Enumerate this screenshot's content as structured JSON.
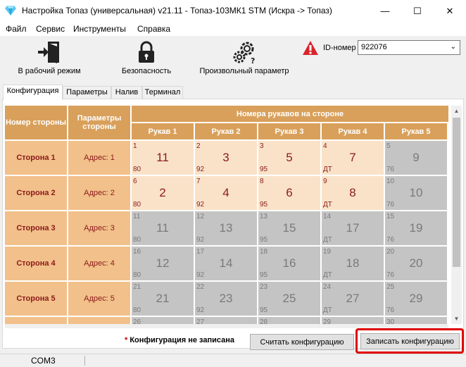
{
  "window": {
    "title": "Настройка Топаз (универсальная) v21.11 - Топаз-103МК1 STM (Искра -> Топаз)",
    "minimize": "—",
    "maximize": "☐",
    "close": "✕"
  },
  "menu": [
    "Файл",
    "Сервис",
    "Инструменты",
    "Справка"
  ],
  "toolbar": {
    "work_mode": "В рабочий режим",
    "security": "Безопасность",
    "custom_param": "Произвольный параметр"
  },
  "device": {
    "id_label": "ID-номер",
    "id_value": "922076"
  },
  "tabs": [
    "Конфигурация",
    "Параметры",
    "Налив",
    "Терминал"
  ],
  "table": {
    "header_side": "Номер стороны",
    "header_params": "Параметры стороны",
    "header_group": "Номера рукавов на стороне",
    "hoses": [
      "Рукав 1",
      "Рукав 2",
      "Рукав 3",
      "Рукав 4",
      "Рукав 5"
    ],
    "rows": [
      {
        "side": "Сторона 1",
        "addr": "Адрес: 1",
        "cells": [
          {
            "n": "1",
            "big": "11",
            "fuel": "80",
            "on": true
          },
          {
            "n": "2",
            "big": "3",
            "fuel": "92",
            "on": true
          },
          {
            "n": "3",
            "big": "5",
            "fuel": "95",
            "on": true
          },
          {
            "n": "4",
            "big": "7",
            "fuel": "ДТ",
            "on": true
          },
          {
            "n": "5",
            "big": "9",
            "fuel": "76",
            "on": false
          }
        ]
      },
      {
        "side": "Сторона 2",
        "addr": "Адрес: 2",
        "cells": [
          {
            "n": "6",
            "big": "2",
            "fuel": "80",
            "on": true
          },
          {
            "n": "7",
            "big": "4",
            "fuel": "92",
            "on": true
          },
          {
            "n": "8",
            "big": "6",
            "fuel": "95",
            "on": true
          },
          {
            "n": "9",
            "big": "8",
            "fuel": "ДТ",
            "on": true
          },
          {
            "n": "10",
            "big": "10",
            "fuel": "76",
            "on": false
          }
        ]
      },
      {
        "side": "Сторона 3",
        "addr": "Адрес: 3",
        "cells": [
          {
            "n": "11",
            "big": "11",
            "fuel": "80",
            "on": false
          },
          {
            "n": "12",
            "big": "13",
            "fuel": "92",
            "on": false
          },
          {
            "n": "13",
            "big": "15",
            "fuel": "95",
            "on": false
          },
          {
            "n": "14",
            "big": "17",
            "fuel": "ДТ",
            "on": false
          },
          {
            "n": "15",
            "big": "19",
            "fuel": "76",
            "on": false
          }
        ]
      },
      {
        "side": "Сторона 4",
        "addr": "Адрес: 4",
        "cells": [
          {
            "n": "16",
            "big": "12",
            "fuel": "80",
            "on": false
          },
          {
            "n": "17",
            "big": "14",
            "fuel": "92",
            "on": false
          },
          {
            "n": "18",
            "big": "16",
            "fuel": "95",
            "on": false
          },
          {
            "n": "19",
            "big": "18",
            "fuel": "ДТ",
            "on": false
          },
          {
            "n": "20",
            "big": "20",
            "fuel": "76",
            "on": false
          }
        ]
      },
      {
        "side": "Сторона 5",
        "addr": "Адрес: 5",
        "cells": [
          {
            "n": "21",
            "big": "21",
            "fuel": "80",
            "on": false
          },
          {
            "n": "22",
            "big": "23",
            "fuel": "92",
            "on": false
          },
          {
            "n": "23",
            "big": "25",
            "fuel": "95",
            "on": false
          },
          {
            "n": "24",
            "big": "27",
            "fuel": "ДТ",
            "on": false
          },
          {
            "n": "25",
            "big": "29",
            "fuel": "76",
            "on": false
          }
        ]
      },
      {
        "side": "",
        "addr": "",
        "cells": [
          {
            "n": "26",
            "big": "",
            "fuel": "",
            "on": false
          },
          {
            "n": "27",
            "big": "",
            "fuel": "",
            "on": false
          },
          {
            "n": "28",
            "big": "",
            "fuel": "",
            "on": false
          },
          {
            "n": "29",
            "big": "",
            "fuel": "",
            "on": false
          },
          {
            "n": "30",
            "big": "",
            "fuel": "",
            "on": false
          }
        ]
      }
    ]
  },
  "footer": {
    "star": "*",
    "notice": "Конфигурация не записана",
    "read_btn": "Считать конфигурацию",
    "write_btn": "Записать конфигурацию"
  },
  "status": {
    "port": "COM3"
  },
  "colors": {
    "header": "#d9a05b",
    "side_cell": "#f2c08a",
    "active_cell": "#f9e2c8",
    "inactive_cell": "#c4c4c4",
    "accent_text": "#8b1a1a",
    "warning": "#d9242b",
    "highlight": "#e00000"
  },
  "icons": [
    "diamond-app-icon",
    "exit-door-icon",
    "padlock-icon",
    "gear-question-icon",
    "warning-icon",
    "chevron-down-icon"
  ]
}
